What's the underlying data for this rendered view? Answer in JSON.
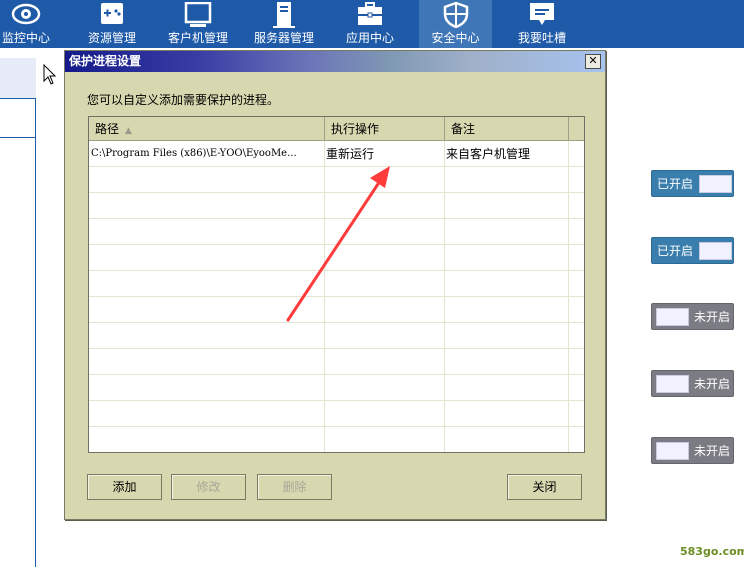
{
  "nav": {
    "items": [
      {
        "label": "监控中心",
        "icon": "eye-icon"
      },
      {
        "label": "资源管理",
        "icon": "gamepad-icon"
      },
      {
        "label": "客户机管理",
        "icon": "monitor-icon"
      },
      {
        "label": "服务器管理",
        "icon": "server-icon"
      },
      {
        "label": "应用中心",
        "icon": "toolbox-icon"
      },
      {
        "label": "安全中心",
        "icon": "shield-icon",
        "active": true
      },
      {
        "label": "我要吐槽",
        "icon": "speech-bubble-icon"
      }
    ]
  },
  "dialog": {
    "title": "保护进程设置",
    "close_glyph": "✕",
    "hint": "您可以自定义添加需要保护的进程。",
    "columns": {
      "path": "路径",
      "action": "执行操作",
      "note": "备注"
    },
    "rows": [
      {
        "path": "C:\\Program Files (x86)\\E-YOO\\EyooMe...",
        "action": "重新运行",
        "note": "来自客户机管理"
      }
    ],
    "buttons": {
      "add": "添加",
      "edit": "修改",
      "delete": "删除",
      "close": "关闭"
    }
  },
  "toggles": [
    {
      "label": "已开启",
      "on": true
    },
    {
      "label": "已开启",
      "on": true
    },
    {
      "label": "未开启",
      "on": false
    },
    {
      "label": "未开启",
      "on": false
    },
    {
      "label": "未开启",
      "on": false
    }
  ],
  "watermark": "583go.com",
  "colors": {
    "nav_bg": "#1e5aa8",
    "nav_active": "#3f76b8",
    "dialog_bg": "#d8d8b0",
    "toggle_on": "#3a7eae",
    "toggle_off": "#7b7b84",
    "annotation_arrow": "#ff3b3b"
  }
}
